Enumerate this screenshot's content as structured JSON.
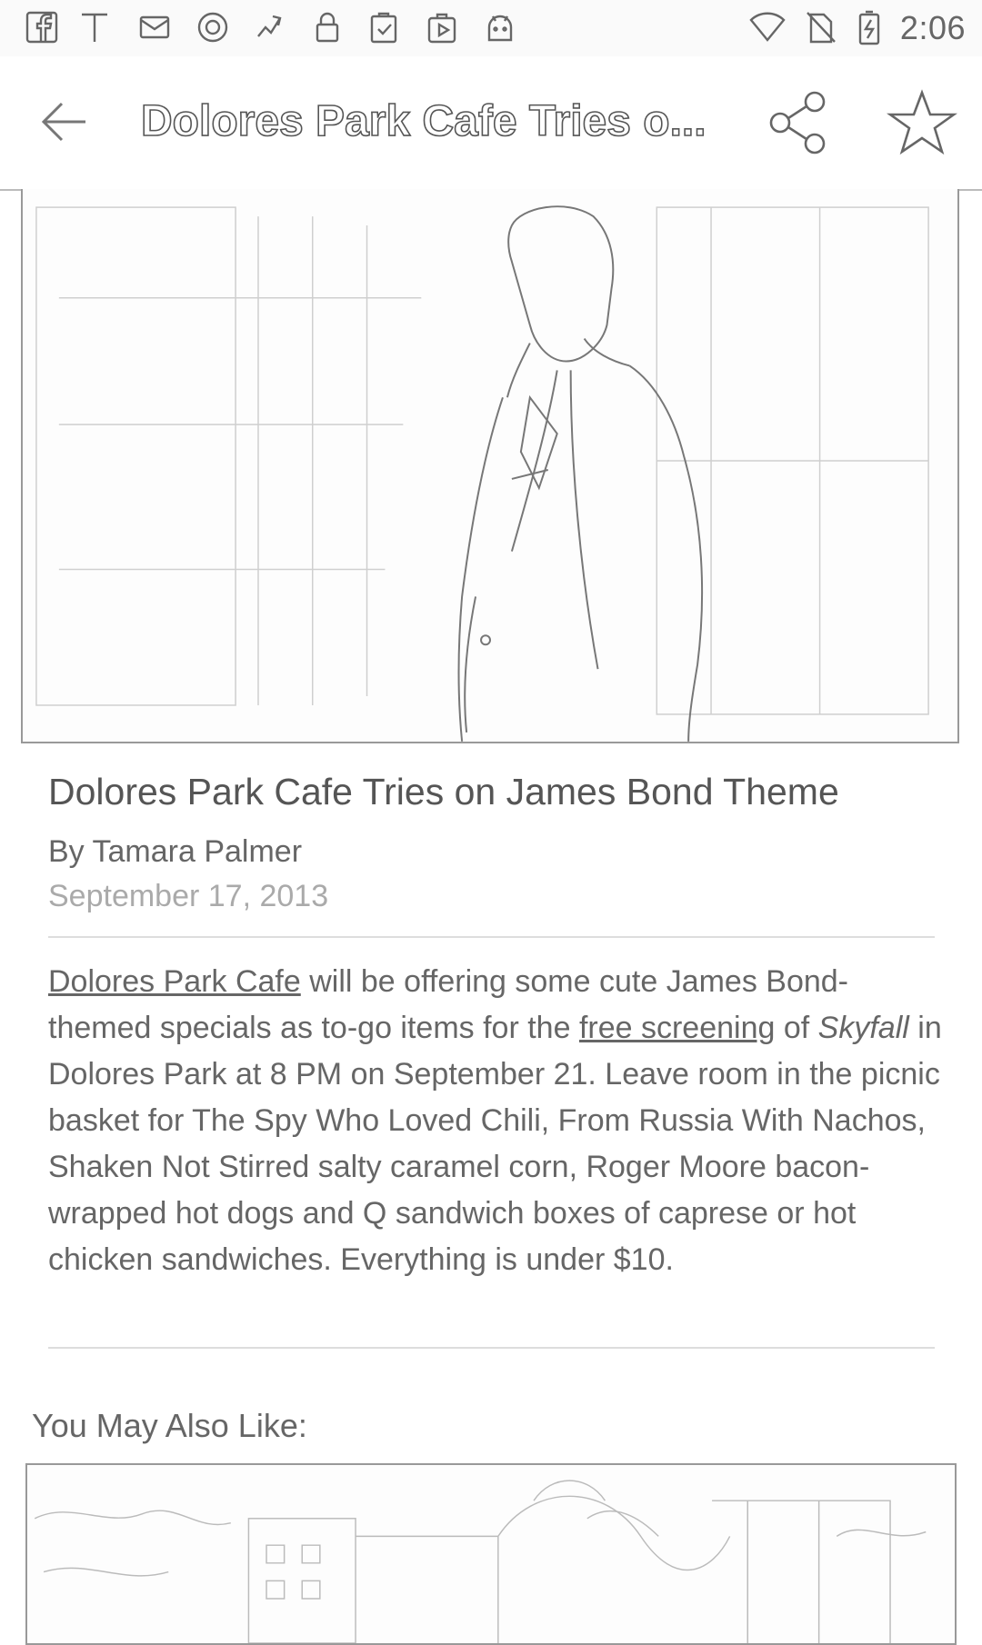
{
  "status_bar": {
    "time": "2:06",
    "left_icons": [
      "facebook-icon",
      "text-icon",
      "mail-icon",
      "record-icon",
      "fan-icon",
      "lock-icon",
      "clipboard-check-icon",
      "play-store-icon",
      "android-icon"
    ],
    "right_icons": [
      "wifi-icon",
      "no-sim-icon",
      "battery-charging-icon"
    ]
  },
  "app_bar": {
    "title": "Dolores Park Cafe Tries o...",
    "back_icon": "arrow-back-icon",
    "share_icon": "share-icon",
    "favorite_icon": "star-outline-icon"
  },
  "article": {
    "hero_image": "photo of man in suit",
    "headline": "Dolores Park Cafe Tries on James Bond Theme",
    "byline": "By Tamara Palmer",
    "date": "September 17, 2013",
    "body": {
      "link1": "Dolores Park Cafe",
      "text1": " will be offering some cute James Bond-themed specials as to-go items for the ",
      "link2": "free screening",
      "text2": " of ",
      "italic": "Skyfall",
      "text3": " in Dolores Park at 8 PM on September 21. Leave room in the picnic basket for The Spy Who Loved Chili, From Russia With Nachos, Shaken Not Stirred salty caramel corn, Roger Moore bacon-wrapped hot dogs and Q sandwich boxes of caprese or hot chicken sandwiches. Everything is under $10."
    }
  },
  "related": {
    "heading": "You May Also Like:",
    "image": "street scene with trees and buildings"
  }
}
